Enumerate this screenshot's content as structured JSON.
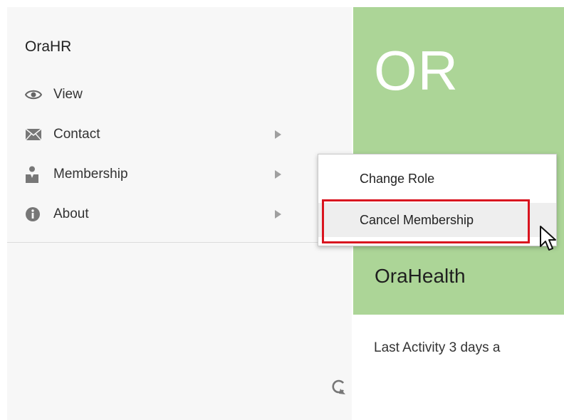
{
  "sidebar": {
    "title": "OraHR",
    "items": [
      {
        "label": "View",
        "icon": "eye-icon",
        "has_submenu": false
      },
      {
        "label": "Contact",
        "icon": "envelope-icon",
        "has_submenu": true
      },
      {
        "label": "Membership",
        "icon": "person-badge-icon",
        "has_submenu": true
      },
      {
        "label": "About",
        "icon": "info-icon",
        "has_submenu": true
      }
    ],
    "refresh_icon": "refresh-icon"
  },
  "card": {
    "initials": "OR",
    "name": "OraHealth",
    "activity": "Last Activity 3 days a",
    "accent_color": "#acd597"
  },
  "submenu": {
    "items": [
      {
        "label": "Change Role"
      },
      {
        "label": "Cancel Membership",
        "highlighted": true
      }
    ],
    "highlight_color": "#d9141f"
  }
}
